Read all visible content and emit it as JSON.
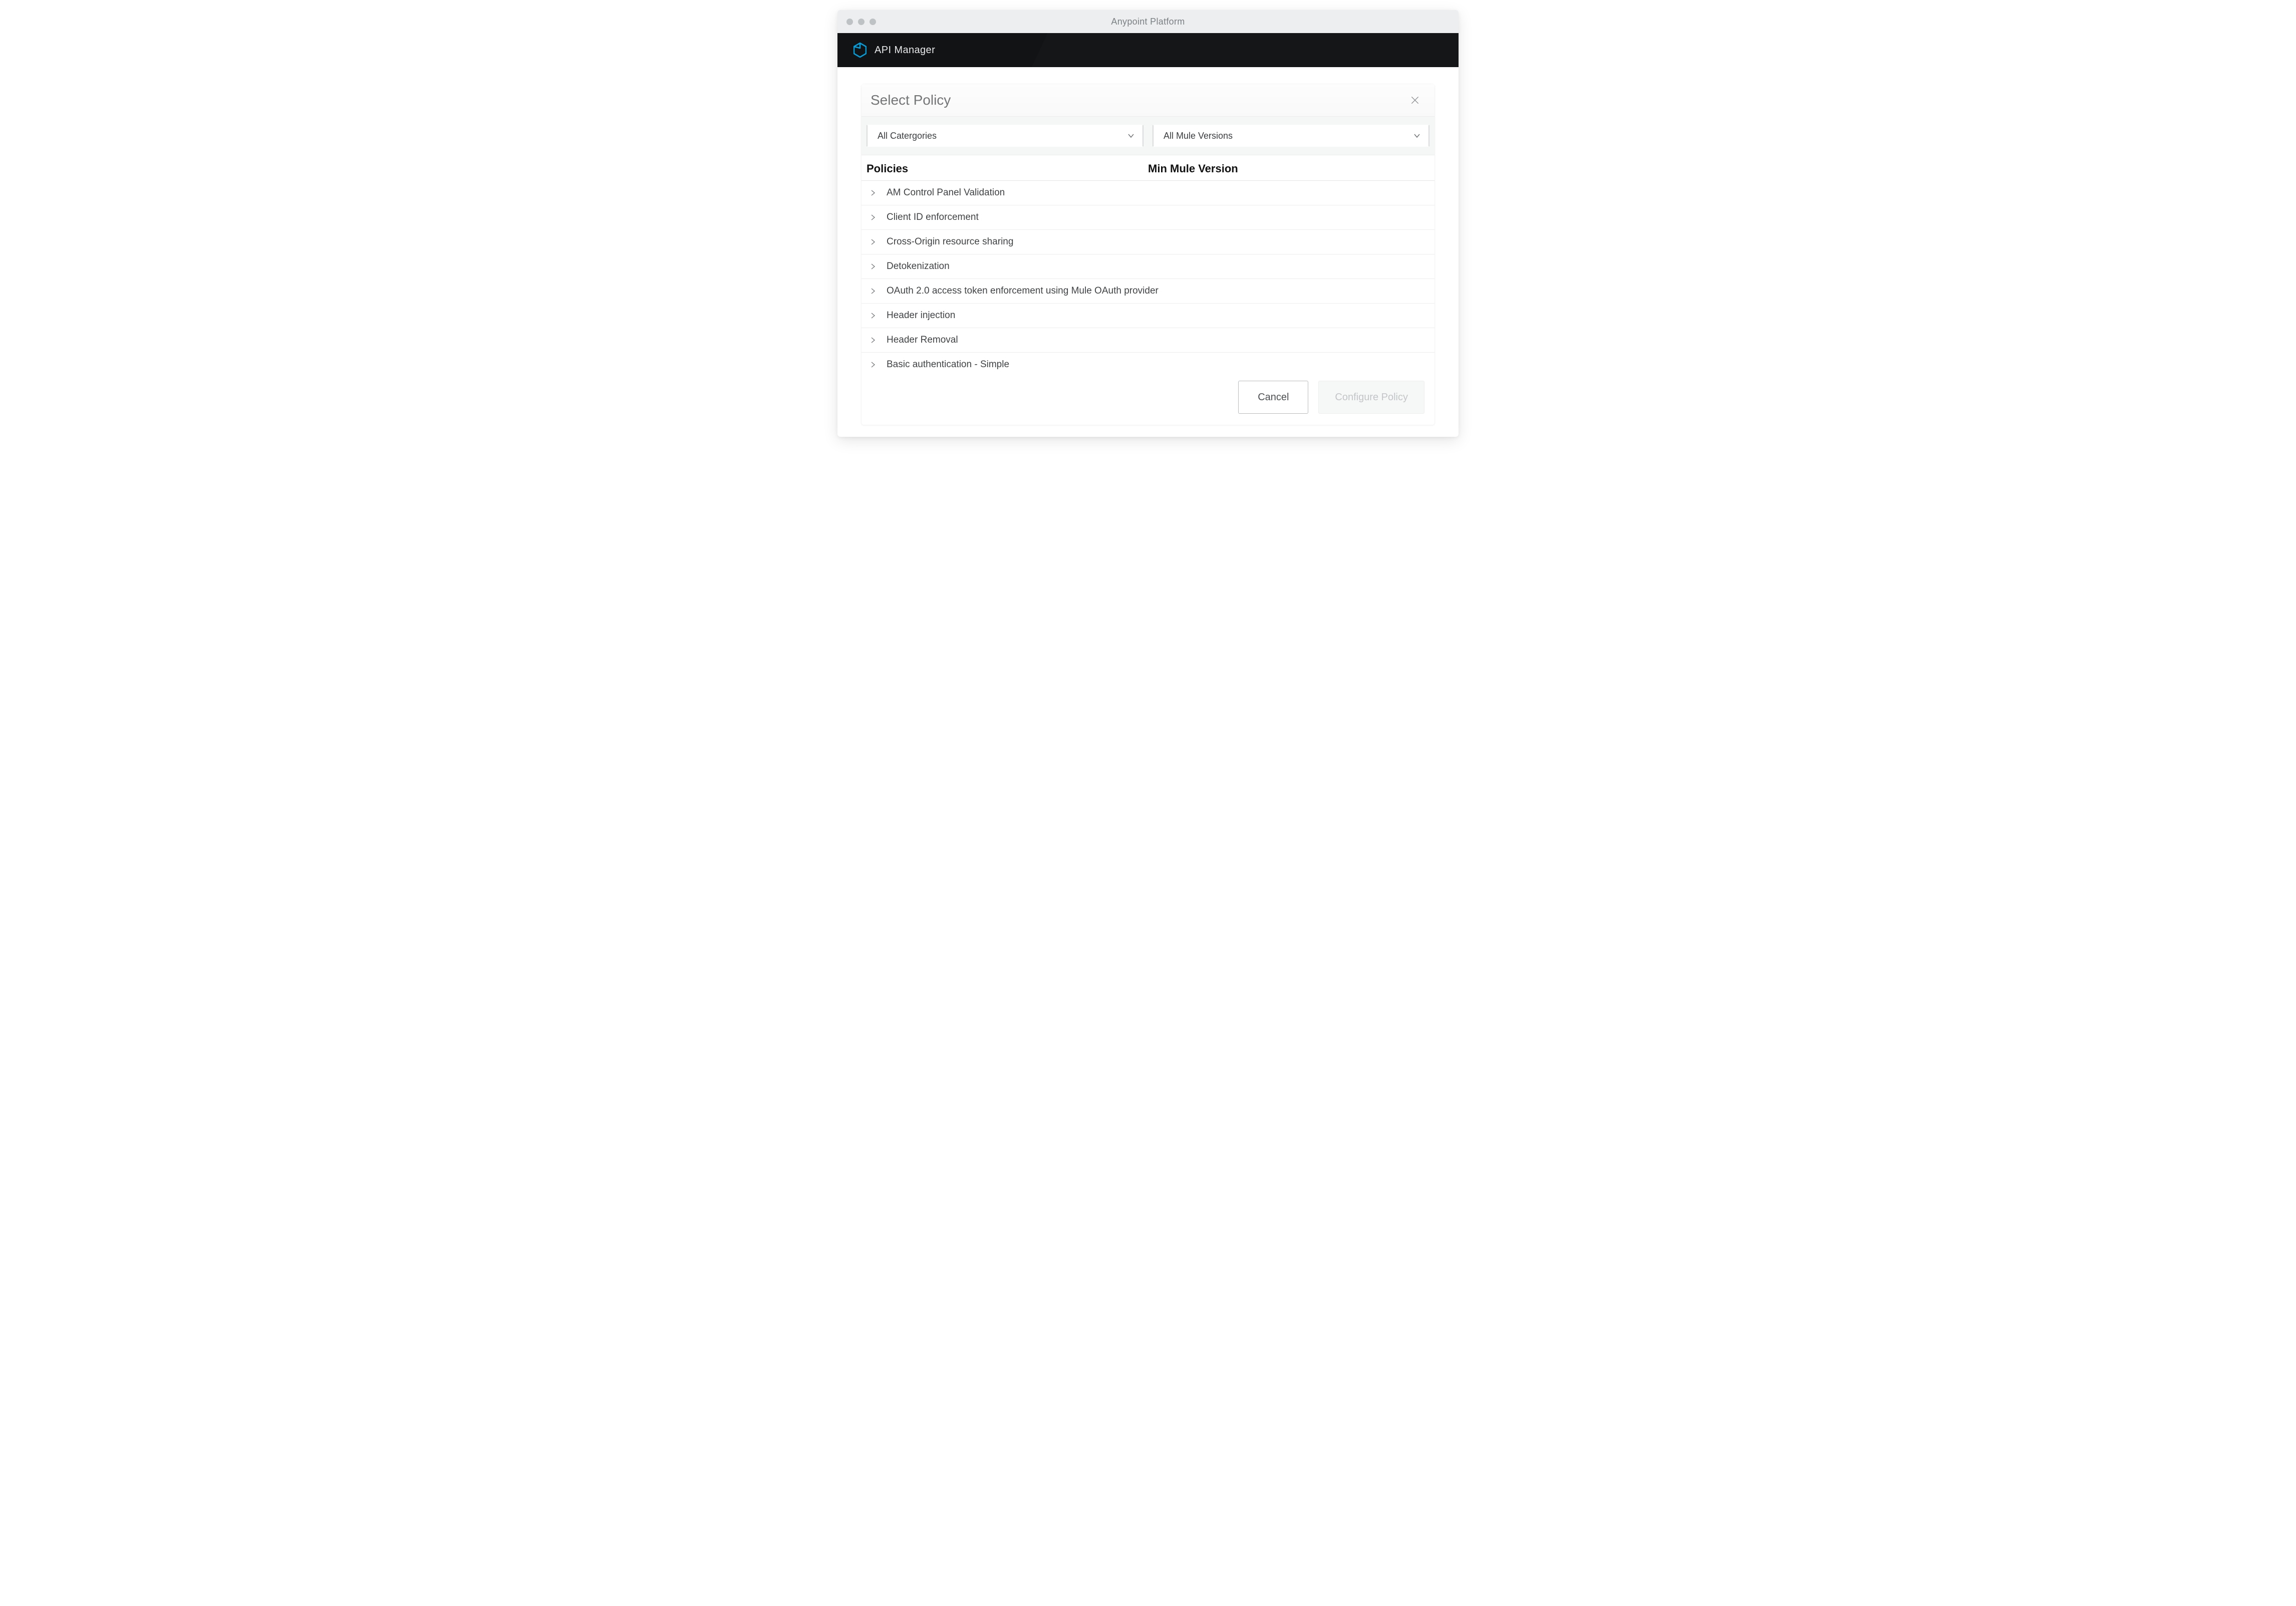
{
  "window": {
    "title": "Anypoint Platform"
  },
  "appbar": {
    "title": "API Manager"
  },
  "panel": {
    "title": "Select Policy"
  },
  "filters": {
    "category": {
      "selected": "All Catergories"
    },
    "mule_version": {
      "selected": "All Mule Versions"
    }
  },
  "columns": {
    "policies": "Policies",
    "min_version": "Min Mule Version"
  },
  "policies": [
    {
      "name": "AM Control Panel Validation"
    },
    {
      "name": "Client ID enforcement"
    },
    {
      "name": "Cross-Origin resource sharing"
    },
    {
      "name": "Detokenization"
    },
    {
      "name": "OAuth 2.0 access token enforcement using Mule OAuth provider"
    },
    {
      "name": "Header injection"
    },
    {
      "name": "Header  Removal"
    },
    {
      "name": "Basic authentication - Simple"
    }
  ],
  "actions": {
    "cancel": "Cancel",
    "configure": "Configure Policy"
  },
  "colors": {
    "accent": "#00a0df",
    "bar": "#131415"
  }
}
